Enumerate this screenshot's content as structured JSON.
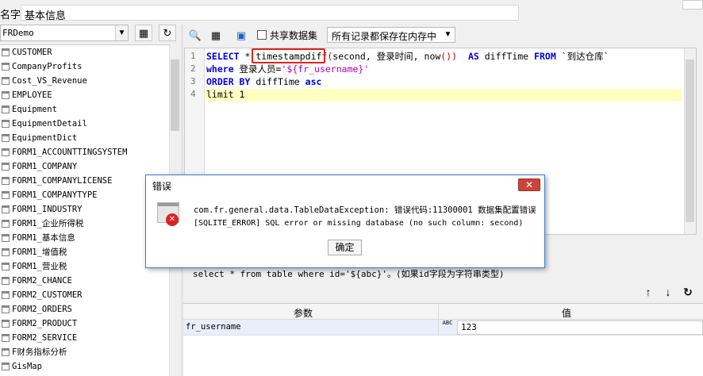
{
  "name_row": {
    "label": "名字:",
    "value": "基本信息"
  },
  "datasource": {
    "selected": "FRDemo"
  },
  "tables": [
    "CUSTOMER",
    "CompanyProfits",
    "Cost_VS_Revenue",
    "EMPLOYEE",
    "Equipment",
    "EquipmentDetail",
    "EquipmentDict",
    "FORM1_ACCOUNTTINGSYSTEM",
    "FORM1_COMPANY",
    "FORM1_COMPANYLICENSE",
    "FORM1_COMPANYTYPE",
    "FORM1_INDUSTRY",
    "FORM1_企业所得税",
    "FORM1_基本信息",
    "FORM1_增值税",
    "FORM1_营业税",
    "FORM2_CHANCE",
    "FORM2_CUSTOMER",
    "FORM2_ORDERS",
    "FORM2_PRODUCT",
    "FORM2_SERVICE",
    "F财务指标分析",
    "GisMap"
  ],
  "toolbar": {
    "share_dataset_label": "共享数据集",
    "memory_option": "所有记录都保存在内存中"
  },
  "sql": {
    "line_numbers": [
      "1",
      "2",
      "3",
      "4"
    ],
    "line1": {
      "kw_select": "SELECT",
      "star": " * ",
      "func": "timestampdiff",
      "paren_open": "(",
      "args": "second, 登录时间, now",
      "now_parens": "()",
      "paren_close": ")",
      "kw_as": "  AS",
      "alias": " diffTime ",
      "kw_from": "FROM",
      "table": " `到达仓库`"
    },
    "line2": {
      "kw_where": "where",
      "cond": " 登录人员=",
      "param": "'${fr_username}'"
    },
    "line3": {
      "kw_order": "ORDER BY",
      "field": " diffTime ",
      "kw_asc": "asc"
    },
    "line4": {
      "text": "limit 1"
    }
  },
  "hint": "select * from table where id='${abc}'。(如果id字段为字符串类型)",
  "params": {
    "header_name": "参数",
    "header_value": "值",
    "rows": [
      {
        "name": "fr_username",
        "type_icon": "ABC",
        "value": "123"
      }
    ]
  },
  "dialog": {
    "title": "错误",
    "message_line1": "com.fr.general.data.TableDataException: 错误代码:11300001 数据集配置错误",
    "message_line2": "[SQLITE_ERROR] SQL error or missing database (no such column: second)",
    "ok_label": "确定"
  }
}
